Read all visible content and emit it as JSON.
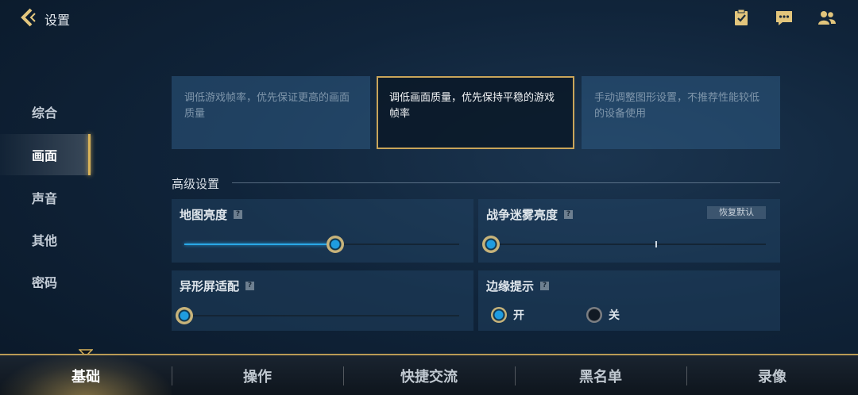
{
  "header": {
    "title": "设置",
    "icons": [
      "back-icon",
      "clipboard-check-icon",
      "chat-icon",
      "friends-icon"
    ]
  },
  "sidebar": {
    "items": [
      {
        "label": "综合",
        "active": false
      },
      {
        "label": "画面",
        "active": true
      },
      {
        "label": "声音",
        "active": false
      },
      {
        "label": "其他",
        "active": false
      },
      {
        "label": "密码",
        "active": false
      }
    ]
  },
  "quality_cards": [
    {
      "text": "调低游戏帧率，优先保证更高的画面质量",
      "selected": false
    },
    {
      "text": "调低画面质量，优先保持平稳的游戏帧率",
      "selected": true
    },
    {
      "text": "手动调整图形设置，不推荐性能较低的设备使用",
      "selected": false
    }
  ],
  "advanced": {
    "title": "高级设置",
    "help_glyph": "?",
    "map_brightness": {
      "label": "地图亮度",
      "value": 0.55
    },
    "fog_brightness": {
      "label": "战争迷雾亮度",
      "value": 0.0,
      "reset_label": "恢复默认"
    },
    "notch_adapt": {
      "label": "异形屏适配",
      "value": 0.0
    },
    "edge_hint": {
      "label": "边缘提示",
      "on_label": "开",
      "off_label": "关",
      "value": "on"
    }
  },
  "bottom_tabs": [
    {
      "label": "基础",
      "active": true
    },
    {
      "label": "操作",
      "active": false
    },
    {
      "label": "快捷交流",
      "active": false
    },
    {
      "label": "黑名单",
      "active": false
    },
    {
      "label": "录像",
      "active": false
    }
  ],
  "colors": {
    "accent_gold": "#c9a55a",
    "slider_blue": "#2aa8e6"
  }
}
